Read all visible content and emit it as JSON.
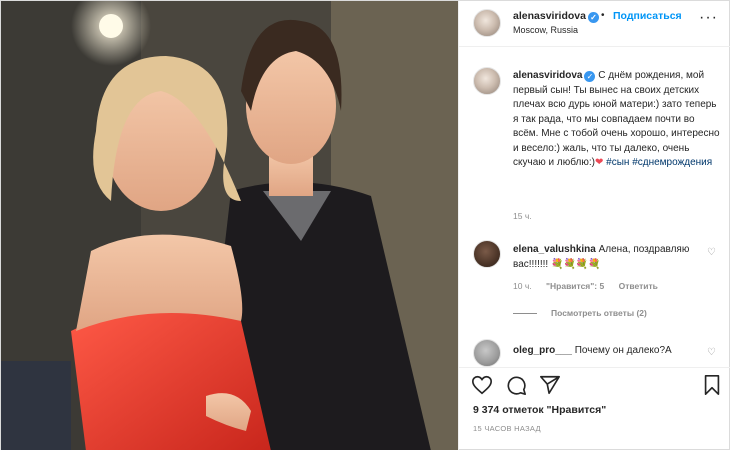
{
  "post": {
    "username": "alenasviridova",
    "follow_label": "Подписаться",
    "separator": "•",
    "location": "Moscow, Russia",
    "more_icon": "more-dots-icon"
  },
  "caption": {
    "username": "alenasviridova",
    "text": "С днём рождения, мой первый сын! Ты вынес на своих детских плечах всю дурь юной матери:) зато теперь я так рада, что мы совпадаем почти во всём. Мне с тобой очень хорошо, интересно и весело:) жаль, что ты далеко, очень скучаю и люблю:)",
    "heart": "❤",
    "hashtag1": "#сын",
    "hashtag2": "#сднемрождения",
    "time": "15 ч."
  },
  "comments": [
    {
      "username": "elena_valushkina",
      "text": "Алена, поздравляю вас!!!!!!! 💐💐💐💐",
      "time": "10 ч.",
      "likes": "\"Нравится\": 5",
      "reply": "Ответить",
      "view_replies": "Посмотреть ответы (2)"
    },
    {
      "username": "oleg_pro___",
      "text": "Почему он далеко?А"
    }
  ],
  "actions": {
    "likes_text": "9 374 отметок \"Нравится\"",
    "ago_text": "15 ЧАСОВ НАЗАД"
  },
  "colors": {
    "accent": "#0095f6",
    "verified": "#3897f0",
    "hashtag": "#00376b",
    "muted": "#8e8e8e"
  }
}
